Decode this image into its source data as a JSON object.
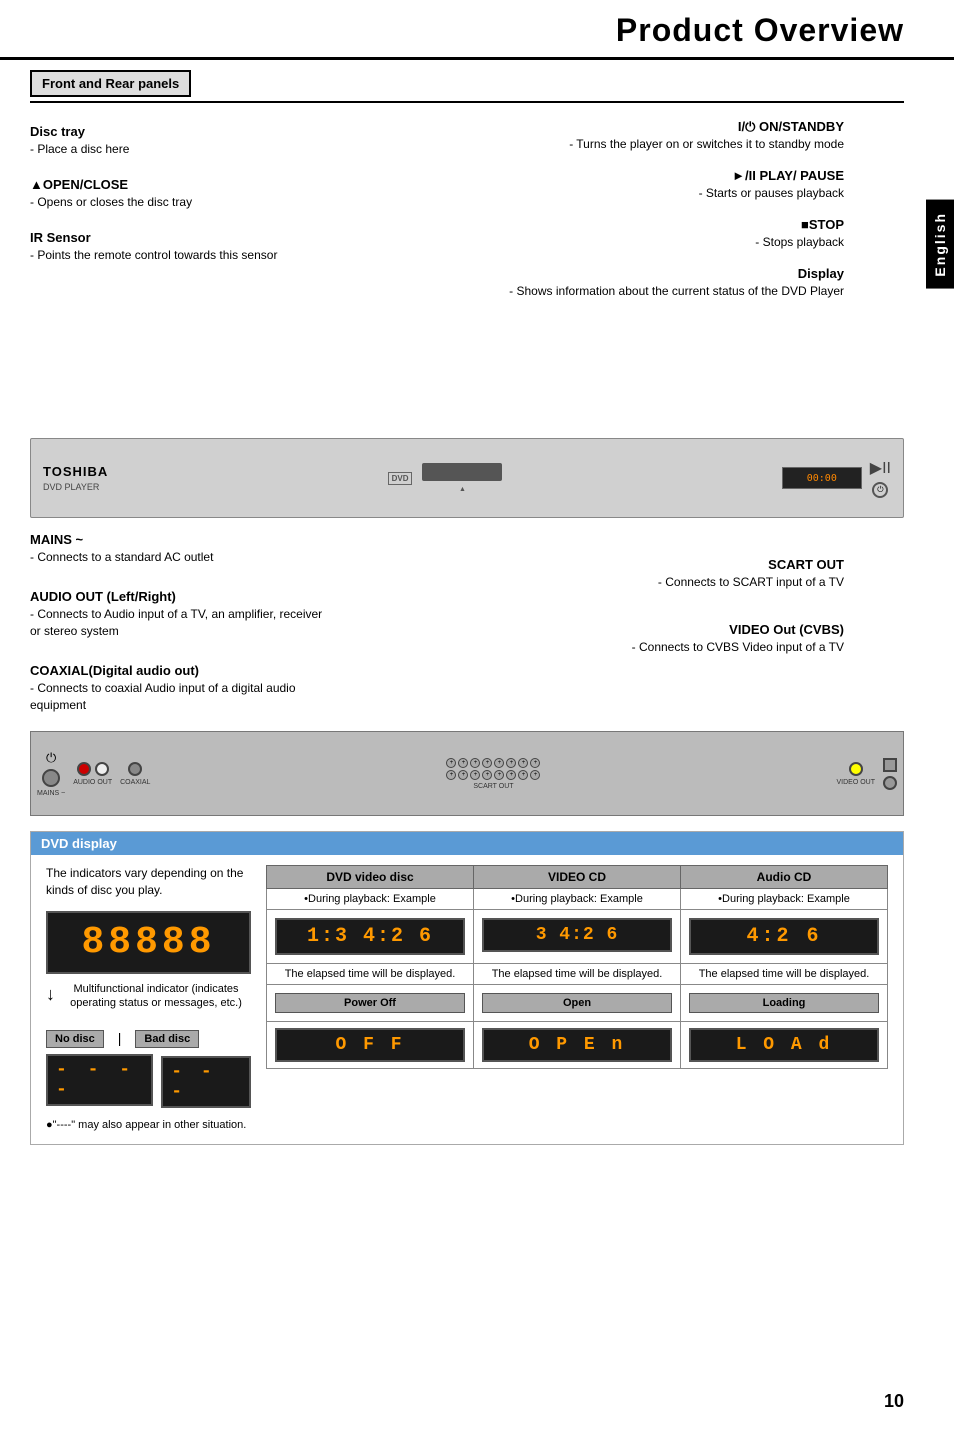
{
  "page": {
    "title": "Product Overview",
    "pageNumber": "10",
    "language": "English"
  },
  "sections": {
    "frontRear": {
      "header": "Front and Rear panels",
      "leftLabels": [
        {
          "title": "Disc tray",
          "desc": "- Place a disc here"
        },
        {
          "title": "▲OPEN/CLOSE",
          "desc": "- Opens or closes the disc tray"
        },
        {
          "title": "IR Sensor",
          "desc": "- Points the remote control towards this sensor"
        }
      ],
      "rightLabels": [
        {
          "title": "I/⏻ ON/STANDBY",
          "desc": "- Turns the player on or switches it to standby mode"
        },
        {
          "title": "►/II PLAY/ PAUSE",
          "desc": "- Starts or pauses playback"
        },
        {
          "title": "■STOP",
          "desc": "- Stops playback"
        },
        {
          "title": "Display",
          "desc": "- Shows information about the current status of the DVD Player"
        }
      ]
    },
    "rearLabels": {
      "leftLabels": [
        {
          "title": "MAINS ~",
          "desc": "- Connects to a standard AC outlet"
        },
        {
          "title": "AUDIO OUT (Left/Right)",
          "desc": "- Connects to Audio input of a TV, an amplifier, receiver or stereo system"
        },
        {
          "title": "COAXIAL(Digital audio out)",
          "desc": "- Connects to coaxial Audio input of a digital audio equipment"
        }
      ],
      "rightLabels": [
        {
          "title": "SCART OUT",
          "desc": "- Connects to SCART input of a TV"
        },
        {
          "title": "VIDEO Out (CVBS)",
          "desc": "- Connects to CVBS  Video input  of a TV"
        }
      ]
    },
    "dvdDisplay": {
      "header": "DVD display",
      "intro": "The indicators vary depending on the kinds of disc you play.",
      "bigDisplayText": "88888",
      "indicatorLabel": "Multifunctional indicator (indicates operating status or messages, etc.)",
      "noDiscLabel": "No disc",
      "badDiscLabel": "Bad disc",
      "dashesLeft": "- - - -",
      "dashesRight": "- - -",
      "bulletNote": "●\"----\" may also appear in other situation.",
      "columns": [
        {
          "header": "DVD video disc",
          "playbackLabel": "•During playback: Example",
          "elapsedText": "1:3 4:2 6",
          "elapsedLabel": "The elapsed time will be displayed.",
          "statusBoxLabel": "Power Off",
          "statusDisplayText": "O F F"
        },
        {
          "header": "VIDEO CD",
          "playbackLabel": "•During playback: Example",
          "elapsedText": "3 4:2 6",
          "elapsedLabel": "The elapsed time will be displayed.",
          "statusBoxLabel": "Open",
          "statusDisplayText": "O P E n"
        },
        {
          "header": "Audio CD",
          "playbackLabel": "•During playback: Example",
          "elapsedText": "4:2 6",
          "elapsedLabel": "The elapsed time will be displayed.",
          "statusBoxLabel": "Loading",
          "statusDisplayText": "L O A d"
        }
      ]
    }
  }
}
